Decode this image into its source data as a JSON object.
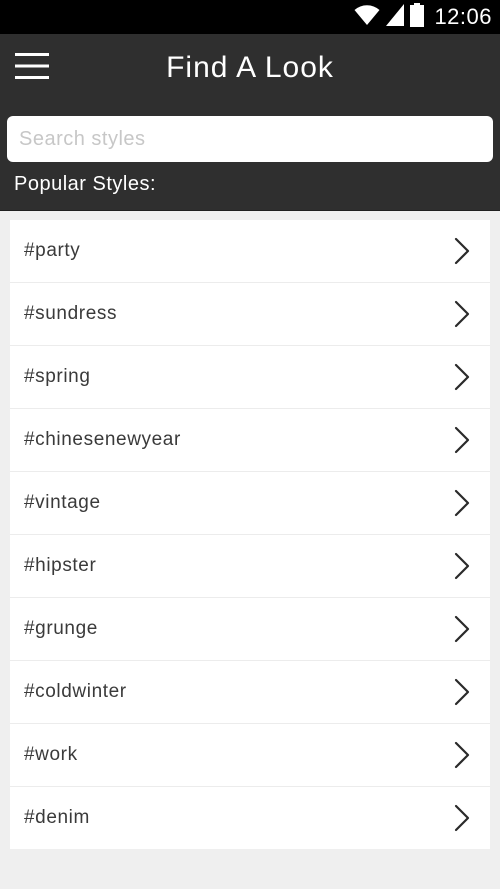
{
  "status_bar": {
    "time": "12:06",
    "icons": [
      "wifi-icon",
      "signal-icon",
      "battery-icon"
    ]
  },
  "header": {
    "title": "Find A Look",
    "menu_icon": "hamburger-menu-icon"
  },
  "search": {
    "placeholder": "Search styles",
    "value": ""
  },
  "section": {
    "label": "Popular Styles:"
  },
  "styles": [
    {
      "label": "#party"
    },
    {
      "label": "#sundress"
    },
    {
      "label": "#spring"
    },
    {
      "label": "#chinesenewyear"
    },
    {
      "label": "#vintage"
    },
    {
      "label": "#hipster"
    },
    {
      "label": "#grunge"
    },
    {
      "label": "#coldwinter"
    },
    {
      "label": "#work"
    },
    {
      "label": "#denim"
    }
  ],
  "colors": {
    "status_bar_bg": "#000000",
    "app_bar_bg": "#2f2f2f",
    "list_bg": "#ffffff",
    "page_bg": "#efefef",
    "text_dark": "#3a3a3a"
  }
}
